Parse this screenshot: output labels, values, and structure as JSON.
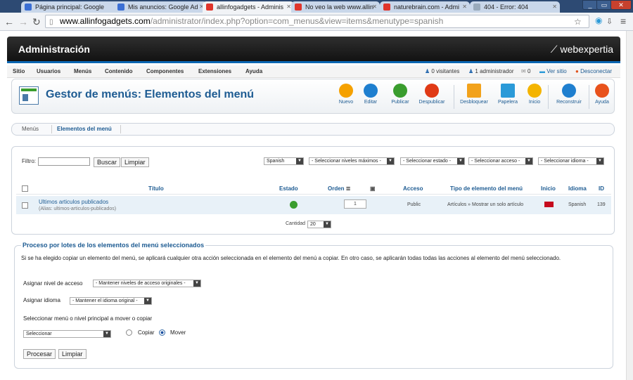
{
  "browser": {
    "tabs": [
      {
        "label": "Página principal: Google"
      },
      {
        "label": "Mis anuncios: Google Ad"
      },
      {
        "label": "allinfogadgets - Adminis"
      },
      {
        "label": "No veo la web www.allin"
      },
      {
        "label": "naturebrain.com - Admi"
      },
      {
        "label": "404 - Error: 404"
      }
    ],
    "url_domain": "www.allinfogadgets.com",
    "url_path": "/administrator/index.php?option=com_menus&view=items&menutype=spanish"
  },
  "admin": {
    "title": "Administración",
    "logo": "webexpertia"
  },
  "menu": [
    "Sitio",
    "Usuarios",
    "Menús",
    "Contenido",
    "Componentes",
    "Extensiones",
    "Ayuda"
  ],
  "status": {
    "visitors": "0 visitantes",
    "admins": "1 administrador",
    "messages": "0",
    "view_site": "Ver sitio",
    "logout": "Desconectar"
  },
  "toolbar": {
    "title": "Gestor de menús: Elementos del menú",
    "buttons": [
      {
        "label": "Nuevo",
        "color": "#f5a100"
      },
      {
        "label": "Editar",
        "color": "#1f7fcf"
      },
      {
        "label": "Publicar",
        "color": "#3a9d2e"
      },
      {
        "label": "Despublicar",
        "color": "#e03a16"
      },
      {
        "label": "Desbloquear",
        "color": "#f2a21b"
      },
      {
        "label": "Papelera",
        "color": "#2b9ad8"
      },
      {
        "label": "Inicio",
        "color": "#f4b400"
      },
      {
        "label": "Reconstruir",
        "color": "#1f7fcf"
      },
      {
        "label": "Ayuda",
        "color": "#e8521c"
      }
    ]
  },
  "subnav": {
    "menus": "Menús",
    "items": "Elementos del menú"
  },
  "filters": {
    "filter_label": "Filtro:",
    "search": "Buscar",
    "clear": "Limpiar",
    "menu_select": "Spanish",
    "levels": "- Seleccionar niveles máximos -",
    "state": "- Seleccionar estado -",
    "access": "- Seleccionar acceso -",
    "language": "- Seleccionar idioma -"
  },
  "table": {
    "headers": {
      "title": "Título",
      "state": "Estado",
      "order": "Orden",
      "access": "Acceso",
      "type": "Tipo de elemento del menú",
      "home": "Inicio",
      "lang": "Idioma",
      "id": "ID"
    },
    "row": {
      "title": "Ultimos articulos publicados",
      "alias": "(Alias: ultimos-articulos-publicados)",
      "order": "1",
      "access": "Public",
      "type": "Artículos » Mostrar un solo artículo",
      "lang": "Spanish",
      "id": "139"
    },
    "count_label": "Cantidad",
    "count_value": "20"
  },
  "batch": {
    "legend": "Proceso por lotes de los elementos del menú seleccionados",
    "info": "Si se ha elegido copiar un elemento del menú, se aplicará cualquier otra acción seleccionada en el elemento del menú a copiar. En otro caso, se aplicarán todas todas las acciones al elemento del menú seleccionado.",
    "access_label": "Asignar nivel de acceso",
    "access_value": "- Mantener niveles de acceso originales -",
    "lang_label": "Asignar idioma",
    "lang_value": "- Mantener el idioma original -",
    "move_label": "Seleccionar menú o nivel principal a mover o copiar",
    "move_value": "Seleccionar",
    "copy": "Copiar",
    "move": "Mover",
    "process": "Procesar",
    "clear": "Limpiar"
  }
}
